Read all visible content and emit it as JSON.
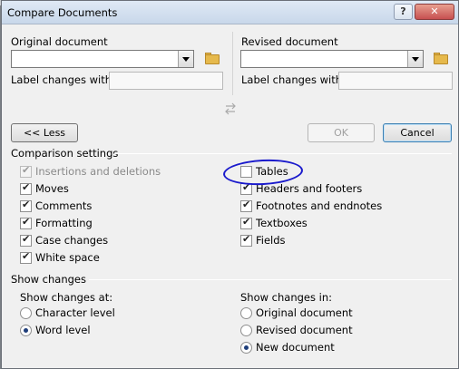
{
  "window": {
    "title": "Compare Documents",
    "help_label": "?",
    "close_label": "✕"
  },
  "original": {
    "heading": "Original document",
    "label_changes": "Label changes with",
    "combo_value": "",
    "label_value": ""
  },
  "revised": {
    "heading": "Revised document",
    "label_changes": "Label changes with",
    "combo_value": "",
    "label_value": ""
  },
  "swap_icon": "swap-arrows-icon",
  "buttons": {
    "less": "<< Less",
    "ok": "OK",
    "cancel": "Cancel"
  },
  "comparison": {
    "heading": "Comparison settings",
    "left": [
      {
        "label": "Insertions and deletions",
        "checked": true,
        "disabled": true
      },
      {
        "label": "Moves",
        "checked": true,
        "disabled": false
      },
      {
        "label": "Comments",
        "checked": true,
        "disabled": false
      },
      {
        "label": "Formatting",
        "checked": true,
        "disabled": false
      },
      {
        "label": "Case changes",
        "checked": true,
        "disabled": false
      },
      {
        "label": "White space",
        "checked": true,
        "disabled": false
      }
    ],
    "right": [
      {
        "label": "Tables",
        "checked": false,
        "disabled": false
      },
      {
        "label": "Headers and footers",
        "checked": true,
        "disabled": false
      },
      {
        "label": "Footnotes and endnotes",
        "checked": true,
        "disabled": false
      },
      {
        "label": "Textboxes",
        "checked": true,
        "disabled": false
      },
      {
        "label": "Fields",
        "checked": true,
        "disabled": false
      }
    ]
  },
  "show_changes": {
    "heading": "Show changes",
    "at_heading": "Show changes at:",
    "at_options": [
      {
        "label": "Character level",
        "selected": false
      },
      {
        "label": "Word level",
        "selected": true
      }
    ],
    "in_heading": "Show changes in:",
    "in_options": [
      {
        "label": "Original document",
        "selected": false
      },
      {
        "label": "Revised document",
        "selected": false
      },
      {
        "label": "New document",
        "selected": true
      }
    ]
  },
  "colors": {
    "annotation_circle": "#1a1acc",
    "title_bar": "#c8d7ea",
    "close_button": "#c75050"
  }
}
